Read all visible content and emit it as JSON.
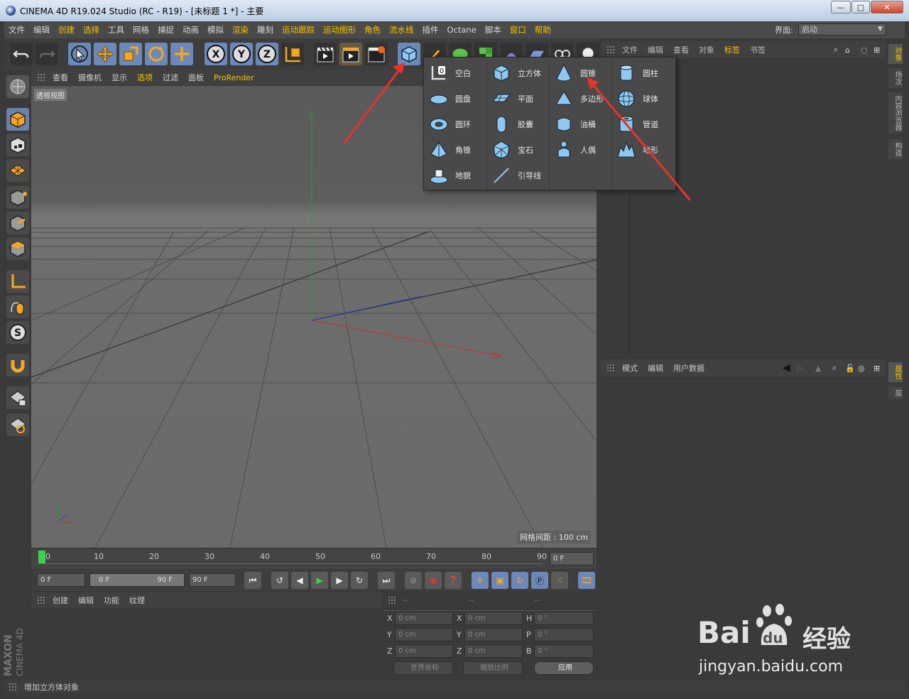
{
  "window": {
    "title": "CINEMA 4D R19.024 Studio (RC - R19) - [未标题 1 *] - 主要",
    "minimize": "—",
    "maximize": "□",
    "close": "✕"
  },
  "menu": [
    "文件",
    "编辑",
    "创建",
    "选择",
    "工具",
    "网格",
    "捕捉",
    "动画",
    "模拟",
    "渲染",
    "雕刻",
    "运动跟踪",
    "运动图形",
    "角色",
    "流水线",
    "插件",
    "Octane",
    "脚本",
    "窗口",
    "帮助"
  ],
  "layout": {
    "label": "界面:",
    "value": "启动"
  },
  "viewport": {
    "menu": [
      "查看",
      "摄像机",
      "显示",
      "选项",
      "过滤",
      "面板",
      "ProRender"
    ],
    "view_name": "透视视图",
    "grid_spacing": "网格间距 : 100 cm"
  },
  "timeline": {
    "ticks": [
      "0",
      "10",
      "20",
      "30",
      "40",
      "50",
      "60",
      "70",
      "80",
      "90"
    ],
    "current_frame": "0 F",
    "start_frame": "0 F",
    "range_start": "0 F",
    "range_end": "90 F",
    "end_frame": "90 F"
  },
  "material_panel": {
    "menu": [
      "创建",
      "编辑",
      "功能",
      "纹理"
    ],
    "logo_line1": "MAXON",
    "logo_line2": "CINEMA 4D"
  },
  "coordinates": {
    "col_headers": [
      "--",
      "--",
      "--"
    ],
    "rows": [
      {
        "a": "X",
        "av": "0 cm",
        "b": "X",
        "bv": "0 cm",
        "c": "H",
        "cv": "0 °"
      },
      {
        "a": "Y",
        "av": "0 cm",
        "b": "Y",
        "bv": "0 cm",
        "c": "P",
        "cv": "0 °"
      },
      {
        "a": "Z",
        "av": "0 cm",
        "b": "Z",
        "bv": "0 cm",
        "c": "B",
        "cv": "0 °"
      }
    ],
    "world_dropdown": "世界坐标",
    "scale_dropdown": "缩放比例",
    "apply_button": "应用"
  },
  "object_manager": {
    "menu": [
      "文件",
      "编辑",
      "查看",
      "对象",
      "标签",
      "书签"
    ],
    "active": "标签"
  },
  "attribute_manager": {
    "menu": [
      "模式",
      "编辑",
      "用户数据"
    ]
  },
  "right_tabs": [
    "对象",
    "场次",
    "内容浏览器",
    "构造"
  ],
  "right_tabs2": [
    "属性",
    "层"
  ],
  "status": "增加立方体对象",
  "popup": {
    "items": [
      [
        "空白",
        "立方体",
        "圆锥",
        "圆柱"
      ],
      [
        "圆盘",
        "平面",
        "多边形",
        "球体"
      ],
      [
        "圆环",
        "胶囊",
        "油桶",
        "管道"
      ],
      [
        "角锥",
        "宝石",
        "人偶",
        "地形"
      ],
      [
        "地貌",
        "引导线",
        "",
        ""
      ]
    ]
  },
  "watermark": {
    "brand": "Bai",
    "brand2": "du",
    "label": "经验",
    "url": "jingyan.baidu.com"
  },
  "colors": {
    "accent": "#f5c400",
    "active_tool": "#6c88b8",
    "arrow": "#e8332b",
    "x_axis": "#c03030",
    "y_axis": "#2e9a3a",
    "z_axis": "#2a3fb8"
  }
}
